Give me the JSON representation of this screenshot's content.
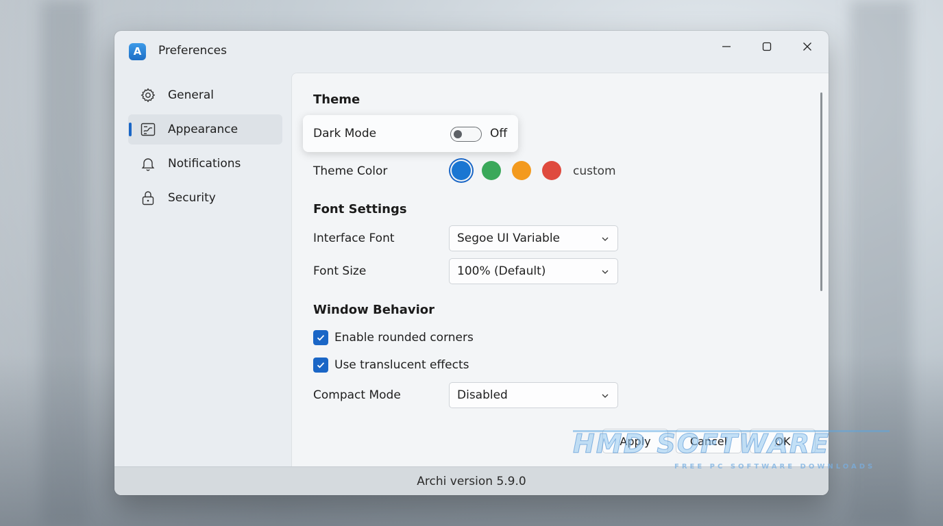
{
  "window": {
    "title": "Preferences",
    "app_icon_letter": "A",
    "controls": {
      "minimize": "minimize-icon",
      "maximize": "maximize-icon",
      "close": "close-icon"
    }
  },
  "sidebar": {
    "items": [
      {
        "label": "General",
        "icon": "gear-icon",
        "active": false
      },
      {
        "label": "Appearance",
        "icon": "appearance-icon",
        "active": true
      },
      {
        "label": "Notifications",
        "icon": "bell-icon",
        "active": false
      },
      {
        "label": "Security",
        "icon": "lock-icon",
        "active": false
      }
    ]
  },
  "theme": {
    "heading": "Theme",
    "dark_mode": {
      "label": "Dark Mode",
      "state_text": "Off",
      "enabled": false
    },
    "theme_color": {
      "label": "Theme Color",
      "swatches": [
        "#1a76d2",
        "#3aa85a",
        "#f39a1e",
        "#df4a3e"
      ],
      "selected_index": 0,
      "custom_label": "custom"
    }
  },
  "font_settings": {
    "heading": "Font Settings",
    "interface_font": {
      "label": "Interface Font",
      "value": "Segoe UI Variable"
    },
    "font_size": {
      "label": "Font Size",
      "value": "100% (Default)"
    }
  },
  "window_behavior": {
    "heading": "Window Behavior",
    "rounded_corners": {
      "label": "Enable rounded corners",
      "checked": true
    },
    "translucent": {
      "label": "Use translucent effects",
      "checked": true
    },
    "compact_mode": {
      "label": "Compact Mode",
      "value": "Disabled"
    }
  },
  "buttons": {
    "apply": "Apply",
    "cancel": "Cancel",
    "ok": "OK"
  },
  "status": {
    "version": "Archi version 5.9.0"
  },
  "watermark": {
    "main": "HMD SOFTWARE",
    "sub": "FREE PC SOFTWARE DOWNLOADS"
  },
  "colors": {
    "accent": "#1a66c6",
    "window_bg": "#e9edf1",
    "content_bg": "#f3f5f7"
  }
}
